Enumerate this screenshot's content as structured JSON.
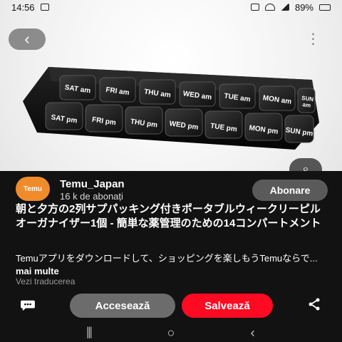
{
  "status": {
    "time": "14:56",
    "battery_percent": "89%"
  },
  "hero": {
    "back_icon": "chevron-left-icon",
    "more_icon": "more-vertical-icon",
    "lens_icon": "lens-search-icon",
    "pill_labels": [
      [
        "SAT am",
        "FRI am",
        "THU am",
        "WED am",
        "TUE am",
        "MON am",
        "SUN am"
      ],
      [
        "SAT pm",
        "FRI pm",
        "THU pm",
        "WED pm",
        "TUE pm",
        "MON pm",
        "SUN pm"
      ]
    ]
  },
  "profile": {
    "avatar_text": "Temu",
    "brand": "Temu_Japan",
    "followers": "16 k de abonați",
    "follow_label": "Abonare"
  },
  "post": {
    "title": "朝と夕方の2列サプパッキング付きポータブルウィークリーピルオーガナイザー1個 - 簡単な薬管理のための14コンパートメント",
    "description": "Temuアプリをダウンロードして、ショッピングを楽しもうTemuならで...",
    "more": "mai multe",
    "translate": "Vezi traducerea"
  },
  "actions": {
    "chat_icon": "chat-bubble-icon",
    "access_label": "Accesează",
    "save_label": "Salvează",
    "share_icon": "share-icon"
  },
  "navbar": {
    "recent_icon": "recent-apps-icon",
    "home_icon": "home-icon",
    "back_icon": "back-nav-icon"
  }
}
